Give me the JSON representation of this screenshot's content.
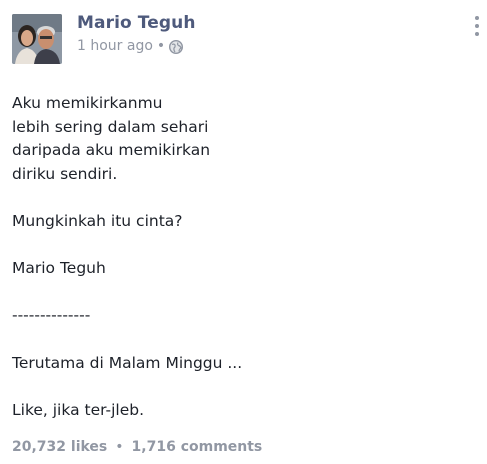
{
  "post": {
    "author": "Mario Teguh",
    "timestamp": "1 hour ago",
    "separator": "•",
    "privacy_icon": "globe-icon",
    "menu_icon": "vertical-ellipsis-icon",
    "lines": [
      "Aku memikirkanmu",
      "lebih sering dalam sehari",
      "daripada aku memikirkan",
      "diriku sendiri.",
      "",
      "Mungkinkah itu cinta?",
      "",
      "Mario Teguh",
      "",
      "--------------",
      "",
      "Terutama di Malam Minggu ...",
      "",
      "Like, jika ter-jleb."
    ],
    "likes": "20,732 likes",
    "stats_separator": "•",
    "comments": "1,716 comments"
  },
  "colors": {
    "author": "#4e5a7c",
    "meta": "#9197a3",
    "text": "#1d2129"
  }
}
